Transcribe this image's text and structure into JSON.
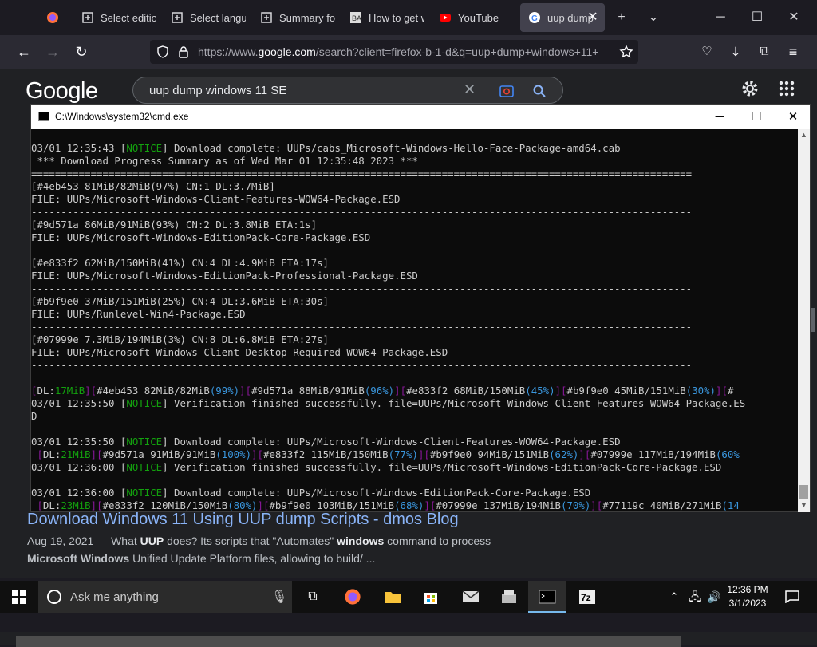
{
  "browser": {
    "tabs": [
      {
        "label": "Select editio",
        "icon": "uup-icon"
      },
      {
        "label": "Select langu",
        "icon": "uup-icon"
      },
      {
        "label": "Summary fo",
        "icon": "uup-icon"
      },
      {
        "label": "How to get w",
        "icon": "site-icon"
      },
      {
        "label": "YouTube",
        "icon": "youtube-icon"
      },
      {
        "label": "uup dump",
        "icon": "google-icon"
      }
    ],
    "url_prefix": "https://www.",
    "url_domain": "google.com",
    "url_rest": "/search?client=firefox-b-1-d&q=uup+dump+windows+11+"
  },
  "google": {
    "logo": "Google",
    "query": "uup dump windows 11 SE",
    "result_title": "Download Windows 11 Using UUP dump Scripts - dmos Blog",
    "result_date": "Aug 19, 2021",
    "result_meta_1": " — What ",
    "result_meta_b1": "UUP",
    "result_meta_2": " does? Its scripts that \"Automates\" ",
    "result_meta_b2": "windows",
    "result_meta_3": " command to process",
    "result_snip_b": "Microsoft Windows",
    "result_snip": " Unified Update Platform files, allowing to build/ ..."
  },
  "cmd": {
    "title": "C:\\Windows\\system32\\cmd.exe",
    "lines": [
      [
        {
          "t": "03/01 12:35:43 ["
        },
        {
          "t": "NOTICE",
          "k": "g"
        },
        {
          "t": "] Download complete: UUPs/cabs_Microsoft-Windows-Hello-Face-Package-amd64.cab"
        }
      ],
      [
        {
          "t": " *** Download Progress Summary as of Wed Mar 01 12:35:48 2023 ***"
        }
      ],
      [
        {
          "t": "==============================================================================================================="
        }
      ],
      [
        {
          "t": "[#4eb453 81MiB/82MiB(97%) CN:1 DL:3.7MiB]"
        }
      ],
      [
        {
          "t": "FILE: UUPs/Microsoft-Windows-Client-Features-WOW64-Package.ESD"
        }
      ],
      [
        {
          "t": "---------------------------------------------------------------------------------------------------------------"
        }
      ],
      [
        {
          "t": "[#9d571a 86MiB/91MiB(93%) CN:2 DL:3.8MiB ETA:1s]"
        }
      ],
      [
        {
          "t": "FILE: UUPs/Microsoft-Windows-EditionPack-Core-Package.ESD"
        }
      ],
      [
        {
          "t": "---------------------------------------------------------------------------------------------------------------"
        }
      ],
      [
        {
          "t": "[#e833f2 62MiB/150MiB(41%) CN:4 DL:4.9MiB ETA:17s]"
        }
      ],
      [
        {
          "t": "FILE: UUPs/Microsoft-Windows-EditionPack-Professional-Package.ESD"
        }
      ],
      [
        {
          "t": "---------------------------------------------------------------------------------------------------------------"
        }
      ],
      [
        {
          "t": "[#b9f9e0 37MiB/151MiB(25%) CN:4 DL:3.6MiB ETA:30s]"
        }
      ],
      [
        {
          "t": "FILE: UUPs/Runlevel-Win4-Package.ESD"
        }
      ],
      [
        {
          "t": "---------------------------------------------------------------------------------------------------------------"
        }
      ],
      [
        {
          "t": "[#07999e 7.3MiB/194MiB(3%) CN:8 DL:6.8MiB ETA:27s]"
        }
      ],
      [
        {
          "t": "FILE: UUPs/Microsoft-Windows-Client-Desktop-Required-WOW64-Package.ESD"
        }
      ],
      [
        {
          "t": "---------------------------------------------------------------------------------------------------------------"
        }
      ],
      [
        {
          "t": ""
        }
      ],
      [
        {
          "t": "[",
          "k": "m"
        },
        {
          "t": "DL:",
          "k": ""
        },
        {
          "t": "17MiB",
          "k": "g"
        },
        {
          "t": "][",
          "k": "m"
        },
        {
          "t": "#4eb453 82MiB/82MiB"
        },
        {
          "t": "(99%)",
          "k": "c"
        },
        {
          "t": "][",
          "k": "m"
        },
        {
          "t": "#9d571a 88MiB/91MiB"
        },
        {
          "t": "(96%)",
          "k": "c"
        },
        {
          "t": "][",
          "k": "m"
        },
        {
          "t": "#e833f2 68MiB/150MiB"
        },
        {
          "t": "(45%)",
          "k": "c"
        },
        {
          "t": "][",
          "k": "m"
        },
        {
          "t": "#b9f9e0 45MiB/151MiB"
        },
        {
          "t": "(30%)",
          "k": "c"
        },
        {
          "t": "][",
          "k": "m"
        },
        {
          "t": "#_"
        }
      ],
      [
        {
          "t": "03/01 12:35:50 ["
        },
        {
          "t": "NOTICE",
          "k": "g"
        },
        {
          "t": "] Verification finished successfully. file=UUPs/Microsoft-Windows-Client-Features-WOW64-Package.ES"
        }
      ],
      [
        {
          "t": "D"
        }
      ],
      [
        {
          "t": ""
        }
      ],
      [
        {
          "t": "03/01 12:35:50 ["
        },
        {
          "t": "NOTICE",
          "k": "g"
        },
        {
          "t": "] Download complete: UUPs/Microsoft-Windows-Client-Features-WOW64-Package.ESD"
        }
      ],
      [
        {
          "t": " [",
          "k": "m"
        },
        {
          "t": "DL:"
        },
        {
          "t": "21MiB",
          "k": "g"
        },
        {
          "t": "][",
          "k": "m"
        },
        {
          "t": "#9d571a 91MiB/91MiB"
        },
        {
          "t": "(100%)",
          "k": "c"
        },
        {
          "t": "][",
          "k": "m"
        },
        {
          "t": "#e833f2 115MiB/150MiB"
        },
        {
          "t": "(77%)",
          "k": "c"
        },
        {
          "t": "][",
          "k": "m"
        },
        {
          "t": "#b9f9e0 94MiB/151MiB"
        },
        {
          "t": "(62%)",
          "k": "c"
        },
        {
          "t": "][",
          "k": "m"
        },
        {
          "t": "#07999e 117MiB/194MiB"
        },
        {
          "t": "(60%",
          "k": "c"
        },
        {
          "t": "_"
        }
      ],
      [
        {
          "t": "03/01 12:36:00 ["
        },
        {
          "t": "NOTICE",
          "k": "g"
        },
        {
          "t": "] Verification finished successfully. file=UUPs/Microsoft-Windows-EditionPack-Core-Package.ESD"
        }
      ],
      [
        {
          "t": ""
        }
      ],
      [
        {
          "t": "03/01 12:36:00 ["
        },
        {
          "t": "NOTICE",
          "k": "g"
        },
        {
          "t": "] Download complete: UUPs/Microsoft-Windows-EditionPack-Core-Package.ESD"
        }
      ],
      [
        {
          "t": " [",
          "k": "m"
        },
        {
          "t": "DL:"
        },
        {
          "t": "23MiB",
          "k": "g"
        },
        {
          "t": "][",
          "k": "m"
        },
        {
          "t": "#e833f2 120MiB/150MiB"
        },
        {
          "t": "(80%)",
          "k": "c"
        },
        {
          "t": "][",
          "k": "m"
        },
        {
          "t": "#b9f9e0 103MiB/151MiB"
        },
        {
          "t": "(68%)",
          "k": "c"
        },
        {
          "t": "][",
          "k": "m"
        },
        {
          "t": "#07999e 137MiB/194MiB"
        },
        {
          "t": "(70%)",
          "k": "c"
        },
        {
          "t": "][",
          "k": "m"
        },
        {
          "t": "#77119c 40MiB/271MiB"
        },
        {
          "t": "(14",
          "k": "c"
        }
      ]
    ]
  },
  "taskbar": {
    "search_placeholder": "Ask me anything",
    "time": "12:36 PM",
    "date": "3/1/2023"
  }
}
